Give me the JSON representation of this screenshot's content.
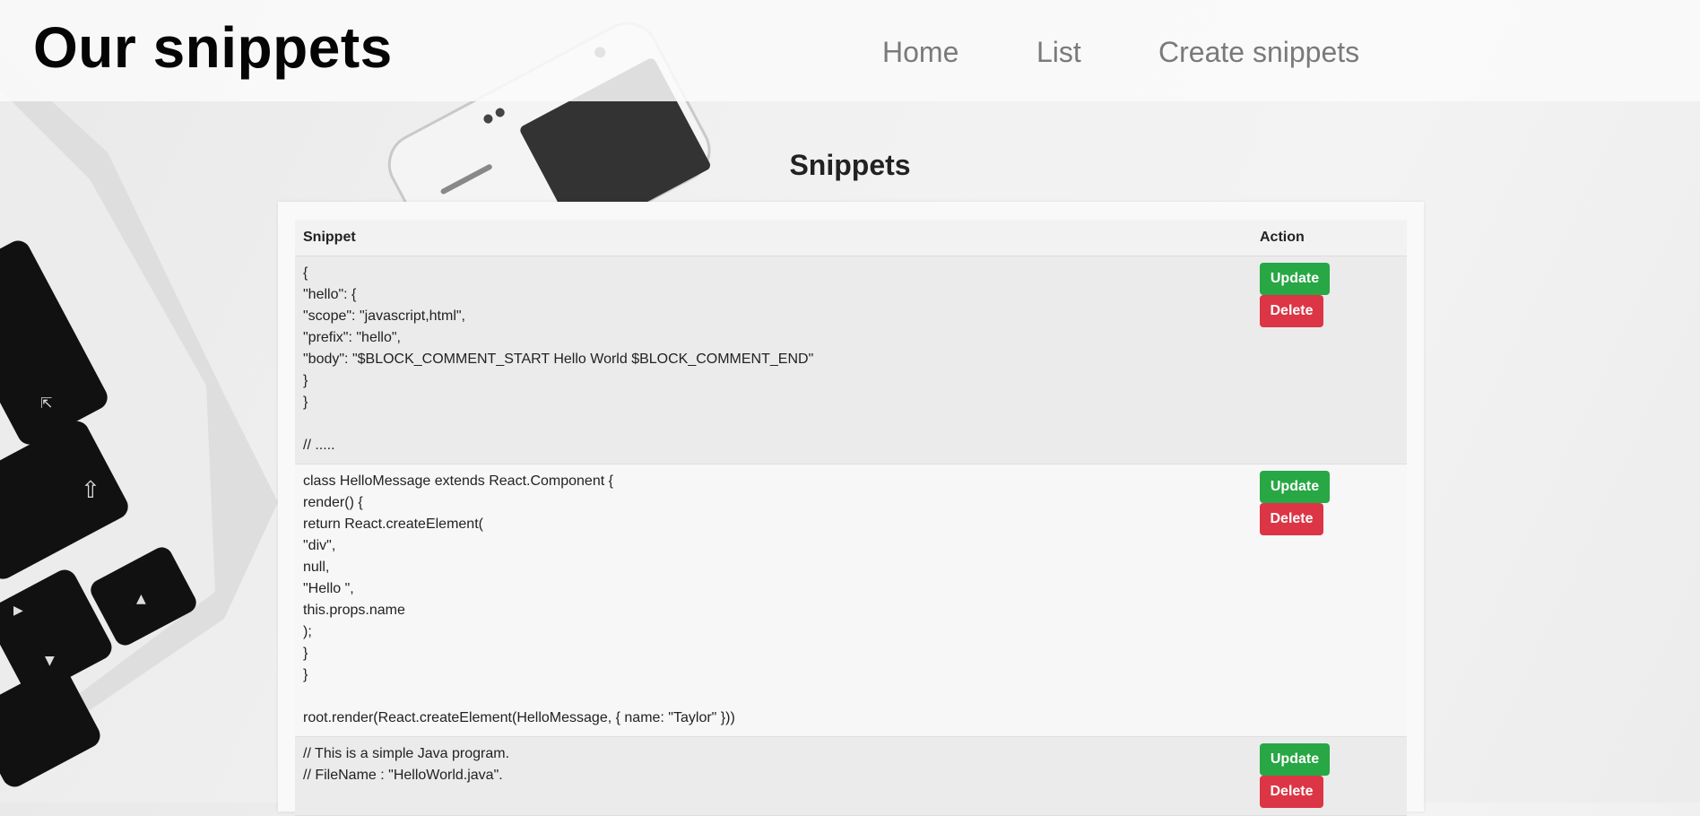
{
  "header": {
    "site_title": "Our snippets",
    "nav": [
      "Home",
      "List",
      "Create snippets"
    ]
  },
  "main": {
    "heading": "Snippets",
    "table": {
      "columns": [
        "Snippet",
        "Action"
      ],
      "rows": [
        {
          "snippet": "{\n\"hello\": {\n\"scope\": \"javascript,html\",\n\"prefix\": \"hello\",\n\"body\": \"$BLOCK_COMMENT_START Hello World $BLOCK_COMMENT_END\"\n}\n}\n\n// .....",
          "update_label": "Update",
          "delete_label": "Delete"
        },
        {
          "snippet": "class HelloMessage extends React.Component {\nrender() {\nreturn React.createElement(\n\"div\",\nnull,\n\"Hello \",\nthis.props.name\n);\n}\n}\n\nroot.render(React.createElement(HelloMessage, { name: \"Taylor\" }))",
          "update_label": "Update",
          "delete_label": "Delete"
        },
        {
          "snippet": "// This is a simple Java program.\n// FileName : \"HelloWorld.java\".",
          "update_label": "Update",
          "delete_label": "Delete"
        }
      ]
    }
  },
  "colors": {
    "update": "#28a745",
    "delete": "#dc3545"
  }
}
